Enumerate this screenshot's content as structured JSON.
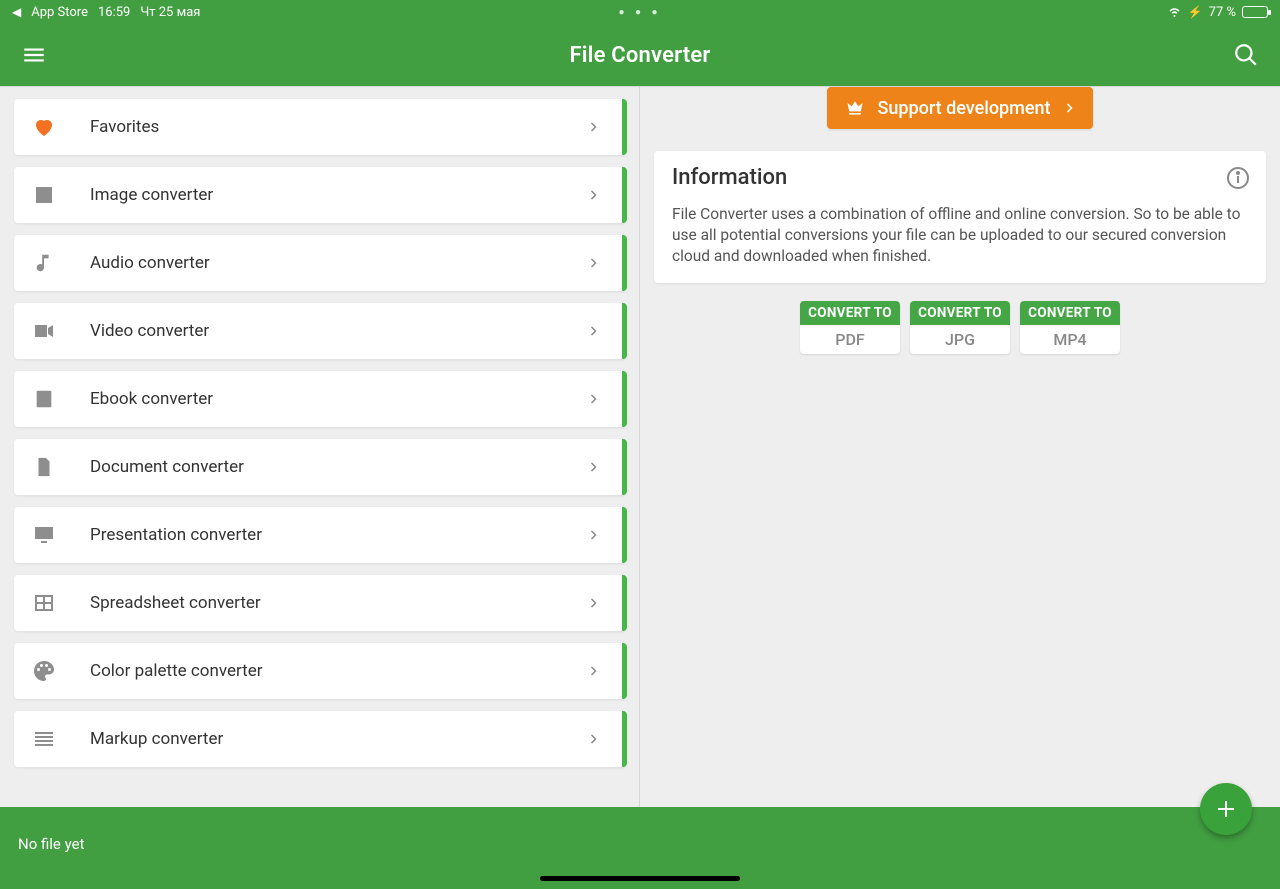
{
  "status_bar": {
    "back_label": "App Store",
    "time": "16:59",
    "date": "Чт 25 мая",
    "battery_percent": "77 %"
  },
  "header": {
    "title": "File Converter"
  },
  "converters": [
    {
      "icon": "heart",
      "label": "Favorites"
    },
    {
      "icon": "image",
      "label": "Image converter"
    },
    {
      "icon": "music-note",
      "label": "Audio converter"
    },
    {
      "icon": "video",
      "label": "Video converter"
    },
    {
      "icon": "book",
      "label": "Ebook converter"
    },
    {
      "icon": "document",
      "label": "Document converter"
    },
    {
      "icon": "monitor",
      "label": "Presentation converter"
    },
    {
      "icon": "table",
      "label": "Spreadsheet converter"
    },
    {
      "icon": "palette",
      "label": "Color palette converter"
    },
    {
      "icon": "lines",
      "label": "Markup converter"
    }
  ],
  "support": {
    "label": "Support development"
  },
  "info": {
    "title": "Information",
    "body": "File Converter uses a combination of offline and online conversion. So to be able to use all potential conversions your file can be uploaded to our secured conversion cloud and downloaded when finished."
  },
  "convert_chips": {
    "top_label": "CONVERT TO",
    "targets": [
      "PDF",
      "JPG",
      "MP4"
    ]
  },
  "bottom": {
    "status": "No file yet"
  }
}
